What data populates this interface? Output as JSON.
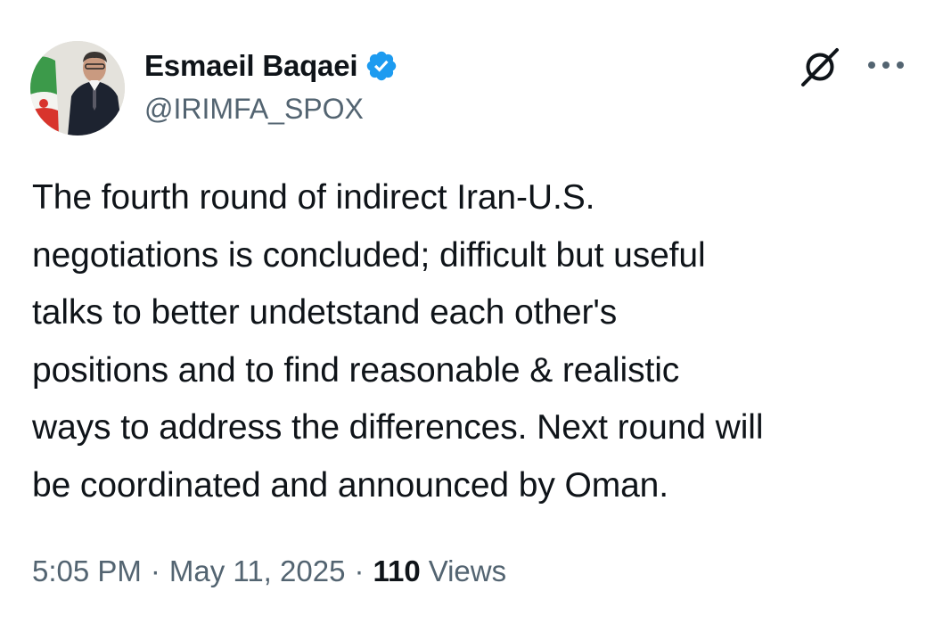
{
  "author": {
    "display_name": "Esmaeil Baqaei",
    "handle": "@IRIMFA_SPOX",
    "verified": true,
    "verified_color": "#1d9bf0"
  },
  "icons": {
    "verified": "verified-badge-icon",
    "grok": "grok-icon",
    "more": "more-options-icon"
  },
  "tweet": {
    "text": "The fourth round of indirect Iran-U.S.\nnegotiations is concluded; difficult but useful\ntalks to better undetstand each other's\npositions and to find reasonable & realistic\nways to address the differences. Next round will\nbe coordinated and announced by Oman."
  },
  "meta": {
    "time": "5:05 PM",
    "separator": "·",
    "date": "May 11, 2025",
    "views_count": "110",
    "views_label": "Views"
  }
}
